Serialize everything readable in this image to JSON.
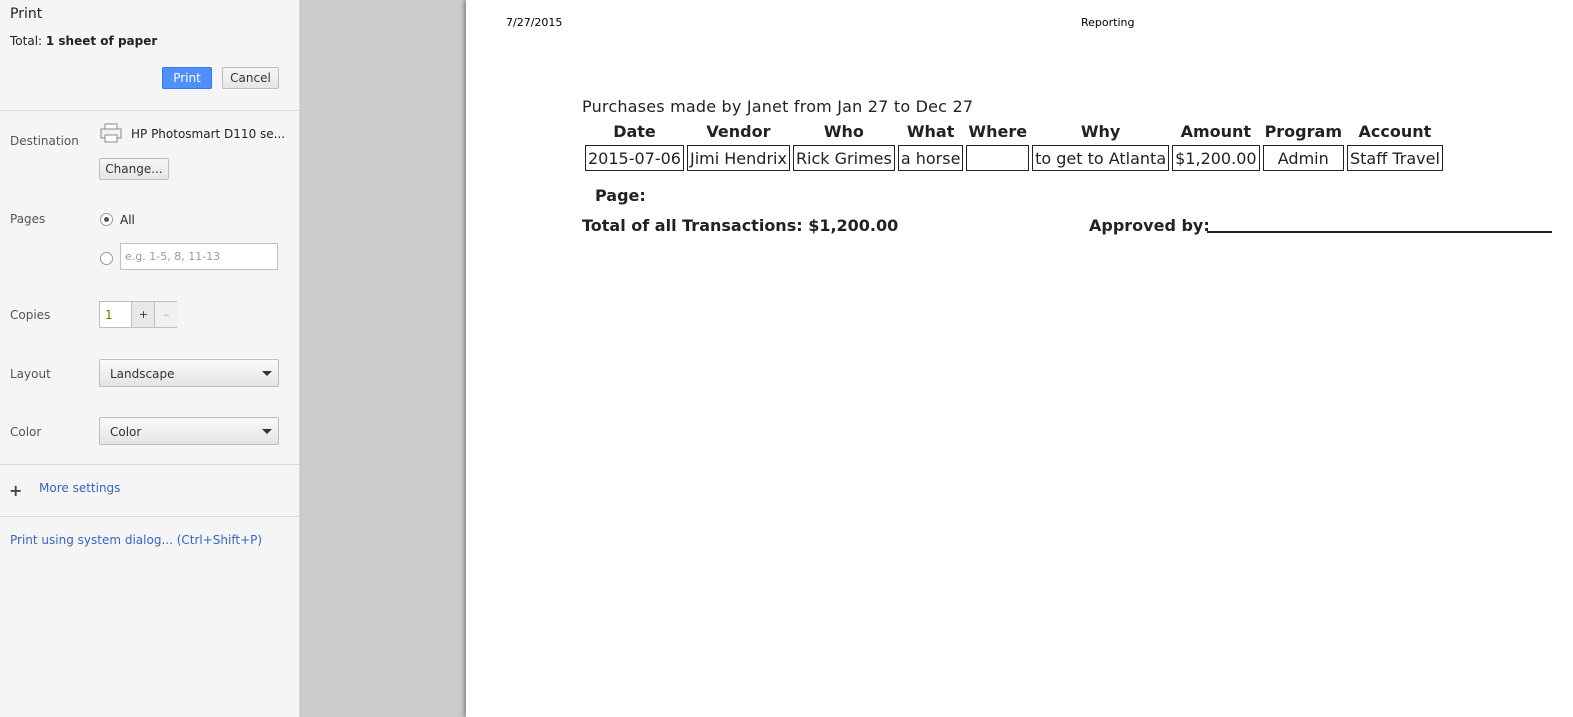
{
  "sidebar": {
    "title": "Print",
    "total_prefix": "Total: ",
    "total_value": "1 sheet of paper",
    "print_label": "Print",
    "cancel_label": "Cancel",
    "destination": {
      "label": "Destination",
      "printer_name": "HP Photosmart D110 se...",
      "change_label": "Change..."
    },
    "pages": {
      "label": "Pages",
      "all_label": "All",
      "custom_placeholder": "e.g. 1-5, 8, 11-13",
      "selected": "All"
    },
    "copies": {
      "label": "Copies",
      "value": "1",
      "plus": "+",
      "minus": "–"
    },
    "layout": {
      "label": "Layout",
      "value": "Landscape"
    },
    "color": {
      "label": "Color",
      "value": "Color"
    },
    "more_settings": "More settings",
    "system_dialog": "Print using system dialog... (Ctrl+Shift+P)"
  },
  "preview": {
    "header_date": "7/27/2015",
    "header_title": "Reporting",
    "report_title": "Purchases made by Janet from Jan 27 to Dec 27",
    "columns": [
      "Date",
      "Vendor",
      "Who",
      "What",
      "Where",
      "Why",
      "Amount",
      "Program",
      "Account"
    ],
    "rows": [
      [
        "2015-07-06",
        "Jimi Hendrix",
        "Rick Grimes",
        "a horse",
        "",
        "to get to Atlanta",
        "$1,200.00",
        "Admin",
        "Staff Travel"
      ]
    ],
    "page_label": "Page:",
    "total_line": "Total of all Transactions: $1,200.00",
    "approved_label": "Approved by:"
  },
  "colors": {
    "print_button": "#4d90fe",
    "link": "#3564c9",
    "preview_background": "#cbcbcb"
  }
}
